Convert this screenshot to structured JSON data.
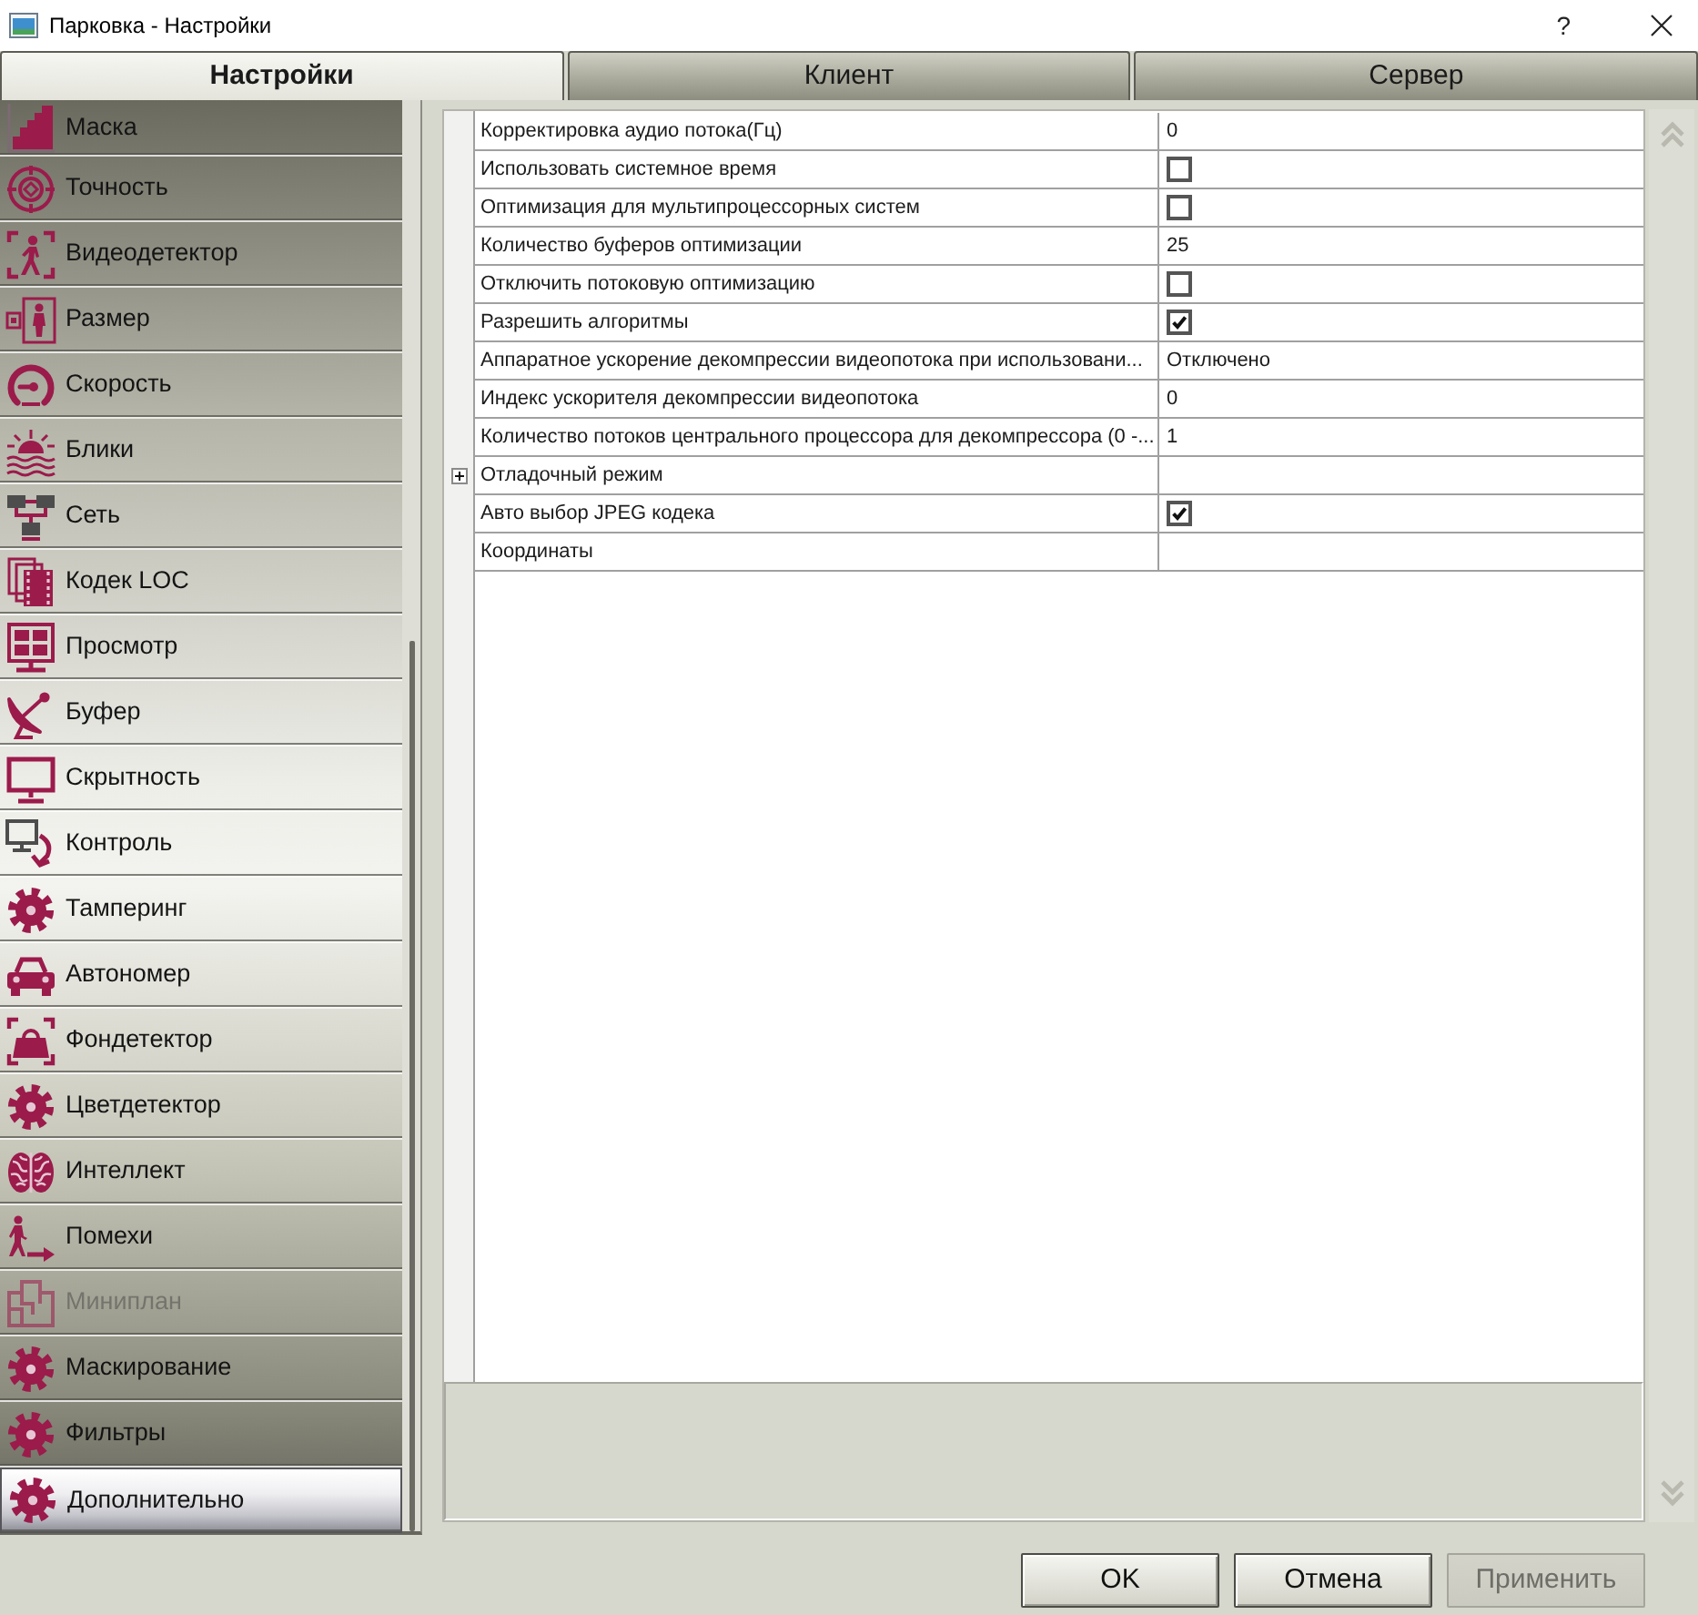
{
  "window": {
    "title": "Парковка - Настройки",
    "help": "?"
  },
  "tabs": [
    {
      "label": "Настройки",
      "selected": true
    },
    {
      "label": "Клиент",
      "selected": false
    },
    {
      "label": "Сервер",
      "selected": false
    }
  ],
  "sidebar": {
    "items": [
      {
        "label": "Маска",
        "selected": false,
        "disabled": false
      },
      {
        "label": "Точность",
        "selected": false,
        "disabled": false
      },
      {
        "label": "Видеодетектор",
        "selected": false,
        "disabled": false
      },
      {
        "label": "Размер",
        "selected": false,
        "disabled": false
      },
      {
        "label": "Скорость",
        "selected": false,
        "disabled": false
      },
      {
        "label": "Блики",
        "selected": false,
        "disabled": false
      },
      {
        "label": "Сеть",
        "selected": false,
        "disabled": false
      },
      {
        "label": "Кодек LOC",
        "selected": false,
        "disabled": false
      },
      {
        "label": "Просмотр",
        "selected": false,
        "disabled": false
      },
      {
        "label": "Буфер",
        "selected": false,
        "disabled": false
      },
      {
        "label": "Скрытность",
        "selected": false,
        "disabled": false
      },
      {
        "label": "Контроль",
        "selected": false,
        "disabled": false
      },
      {
        "label": "Тамперинг",
        "selected": false,
        "disabled": false
      },
      {
        "label": "Автономер",
        "selected": false,
        "disabled": false
      },
      {
        "label": "Фондетектор",
        "selected": false,
        "disabled": false
      },
      {
        "label": "Цветдетектор",
        "selected": false,
        "disabled": false
      },
      {
        "label": "Интеллект",
        "selected": false,
        "disabled": false
      },
      {
        "label": "Помехи",
        "selected": false,
        "disabled": false
      },
      {
        "label": "Миниплан",
        "selected": false,
        "disabled": true
      },
      {
        "label": "Маскирование",
        "selected": false,
        "disabled": false
      },
      {
        "label": "Фильтры",
        "selected": false,
        "disabled": false
      },
      {
        "label": "Дополнительно",
        "selected": true,
        "disabled": false
      }
    ]
  },
  "properties": {
    "rows": [
      {
        "kind": "text",
        "name": "Корректировка аудио потока(Гц)",
        "value": "0"
      },
      {
        "kind": "checkbox",
        "name": "Использовать системное время",
        "checked": false
      },
      {
        "kind": "checkbox",
        "name": "Оптимизация для мультипроцессорных систем",
        "checked": false
      },
      {
        "kind": "text",
        "name": "Количество буферов оптимизации",
        "value": "25"
      },
      {
        "kind": "checkbox",
        "name": "Отключить потоковую оптимизацию",
        "checked": false
      },
      {
        "kind": "checkbox",
        "name": "Разрешить алгоритмы",
        "checked": true
      },
      {
        "kind": "text",
        "name": "Аппаратное ускорение декомпрессии видеопотока при использовани...",
        "value": "Отключено"
      },
      {
        "kind": "text",
        "name": "Индекс ускорителя декомпрессии видеопотока",
        "value": "0"
      },
      {
        "kind": "text",
        "name": "Количество потоков центрального процессора для декомпрессора (0 -...",
        "value": "1"
      },
      {
        "kind": "group",
        "name": "Отладочный режим",
        "expanded": false
      },
      {
        "kind": "checkbox",
        "name": "Авто выбор JPEG кодека",
        "checked": true
      },
      {
        "kind": "text",
        "name": "Координаты"
      }
    ]
  },
  "buttons": [
    {
      "label": "OK",
      "disabled": false
    },
    {
      "label": "Отмена",
      "disabled": false
    },
    {
      "label": "Применить",
      "disabled": true
    }
  ]
}
